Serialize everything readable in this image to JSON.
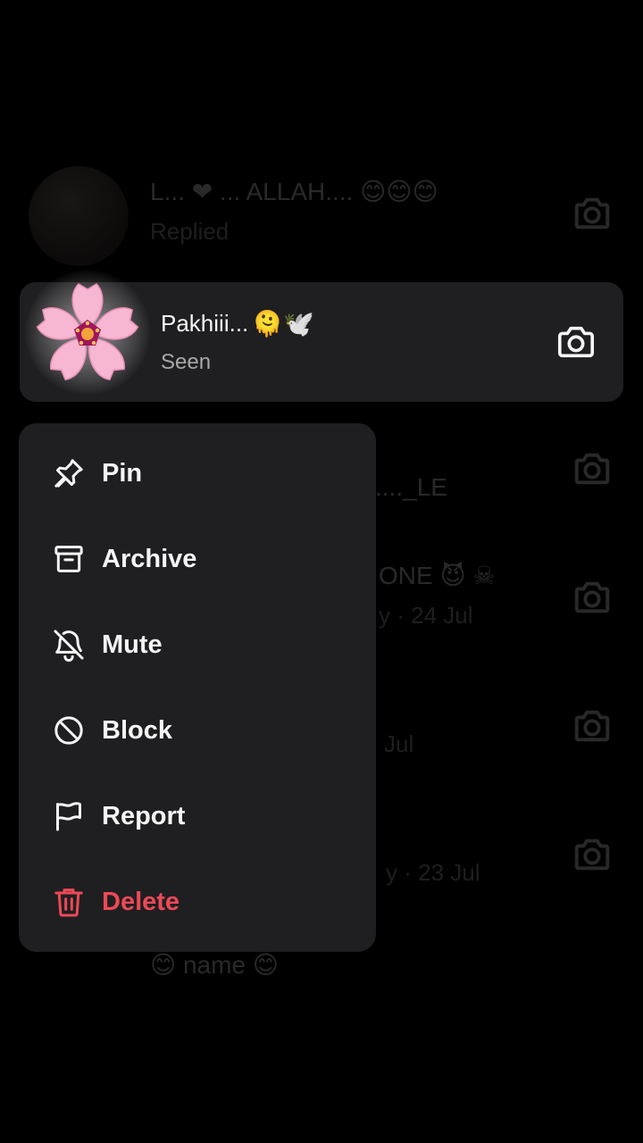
{
  "background_list": [
    {
      "name": "L... ❤ ... ALLAH.... 😊😊😊",
      "subtitle": "Replied"
    },
    {
      "name": "",
      "subtitle": ""
    },
    {
      "name": "...._LE",
      "subtitle": ""
    },
    {
      "name": "ONE 😈 ☠",
      "subtitle": "y · 24 Jul"
    },
    {
      "name": "",
      "subtitle": "Jul"
    },
    {
      "name": "",
      "subtitle": "y · 23 Jul"
    },
    {
      "name": "😊 name 😊",
      "subtitle": ""
    }
  ],
  "focused_chat": {
    "name": "Pakhiii...",
    "name_emojis": "🫠🕊️",
    "status": "Seen",
    "camera_icon": "camera-icon",
    "avatar_icon": "sakura-flower-icon"
  },
  "menu": {
    "items": [
      {
        "label": "Pin",
        "icon": "pin-icon"
      },
      {
        "label": "Archive",
        "icon": "archive-icon"
      },
      {
        "label": "Mute",
        "icon": "bell-off-icon"
      },
      {
        "label": "Block",
        "icon": "block-icon"
      },
      {
        "label": "Report",
        "icon": "flag-icon"
      },
      {
        "label": "Delete",
        "icon": "trash-icon"
      }
    ]
  },
  "colors": {
    "background": "#000000",
    "surface": "#1f1f21",
    "text": "#f5f5f5",
    "secondary_text": "#a8a8a8",
    "danger": "#ed4956"
  }
}
